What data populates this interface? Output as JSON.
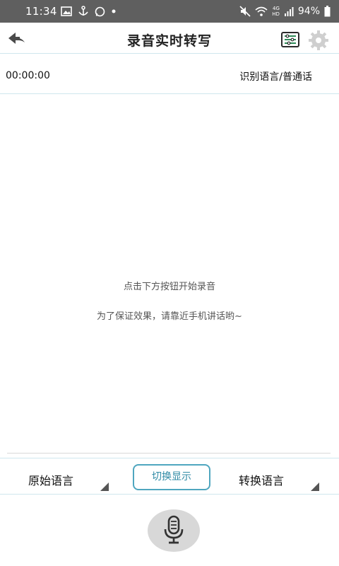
{
  "status_bar": {
    "time": "11:34",
    "battery_percent": "94%",
    "network_small_top": "4G",
    "network_small_left": "HD",
    "left_icons": [
      "gallery-icon",
      "anchor-icon",
      "whatsapp-icon",
      "dot-icon"
    ],
    "right_icons": [
      "mute-icon",
      "wifi-icon",
      "signal-icon",
      "battery-icon"
    ]
  },
  "header": {
    "title": "录音实时转写",
    "back_icon": "back-arrow-icon",
    "list_icon": "list-settings-icon",
    "settings_icon": "gear-icon"
  },
  "info": {
    "timer": "00:00:00",
    "language": "识别语言/普通话"
  },
  "content": {
    "hint_primary": "点击下方按钮开始录音",
    "hint_secondary": "为了保证效果，请靠近手机讲话哟~"
  },
  "controls": {
    "source_language_label": "原始语言",
    "switch_display_label": "切换显示",
    "target_language_label": "转换语言"
  },
  "record": {
    "icon": "microphone-icon"
  },
  "colors": {
    "status_bar": "#5f5f5f",
    "accent": "#4fa6bf",
    "divider": "#cfe7ee",
    "mic_button_bg": "#d8d8d8"
  }
}
